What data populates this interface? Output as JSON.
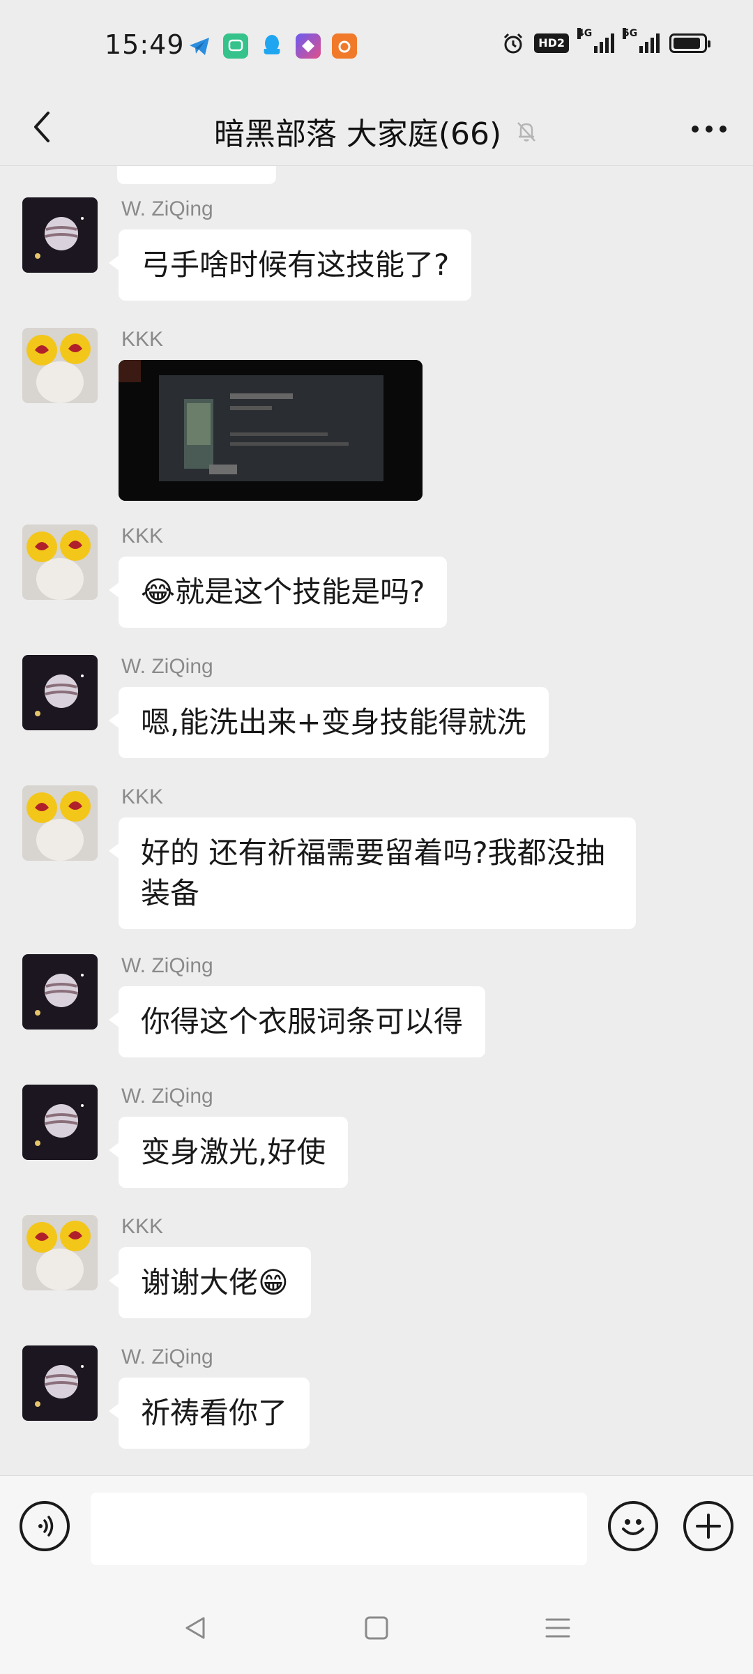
{
  "status_bar": {
    "time": "15:49",
    "hd_label": "HD2",
    "signal_1": "4G",
    "signal_2": "5G",
    "notification_icons": [
      "telegram-icon",
      "messages-icon",
      "qq-icon",
      "shortcut-icon",
      "uc-browser-icon"
    ],
    "battery_level": 0.9
  },
  "header": {
    "title": "暗黑部落 大家庭(66)",
    "muted_icon": "bell-off-icon"
  },
  "messages": [
    {
      "sender": "W. ZiQing",
      "type": "text",
      "text": "弓手啥时候有这技能了?"
    },
    {
      "sender": "KKK",
      "type": "image"
    },
    {
      "sender": "KKK",
      "type": "text",
      "text": "😂就是这个技能是吗?"
    },
    {
      "sender": "W. ZiQing",
      "type": "text",
      "text": "嗯,能洗出来+变身技能得就洗"
    },
    {
      "sender": "KKK",
      "type": "text",
      "text": "好的 还有祈福需要留着吗?我都没抽装备"
    },
    {
      "sender": "W. ZiQing",
      "type": "text",
      "text": "你得这个衣服词条可以得"
    },
    {
      "sender": "W. ZiQing",
      "type": "text",
      "text": "变身激光,好使"
    },
    {
      "sender": "KKK",
      "type": "text",
      "text": "谢谢大佬😁"
    },
    {
      "sender": "W. ZiQing",
      "type": "text",
      "text": "祈祷看你了"
    }
  ],
  "input_bar": {
    "voice_icon": "voice-icon",
    "emoji_icon": "emoji-icon",
    "plus_icon": "plus-icon",
    "input_value": ""
  },
  "colors": {
    "background": "#ededed",
    "bubble": "#ffffff",
    "sender_name": "#8a8a8a"
  }
}
